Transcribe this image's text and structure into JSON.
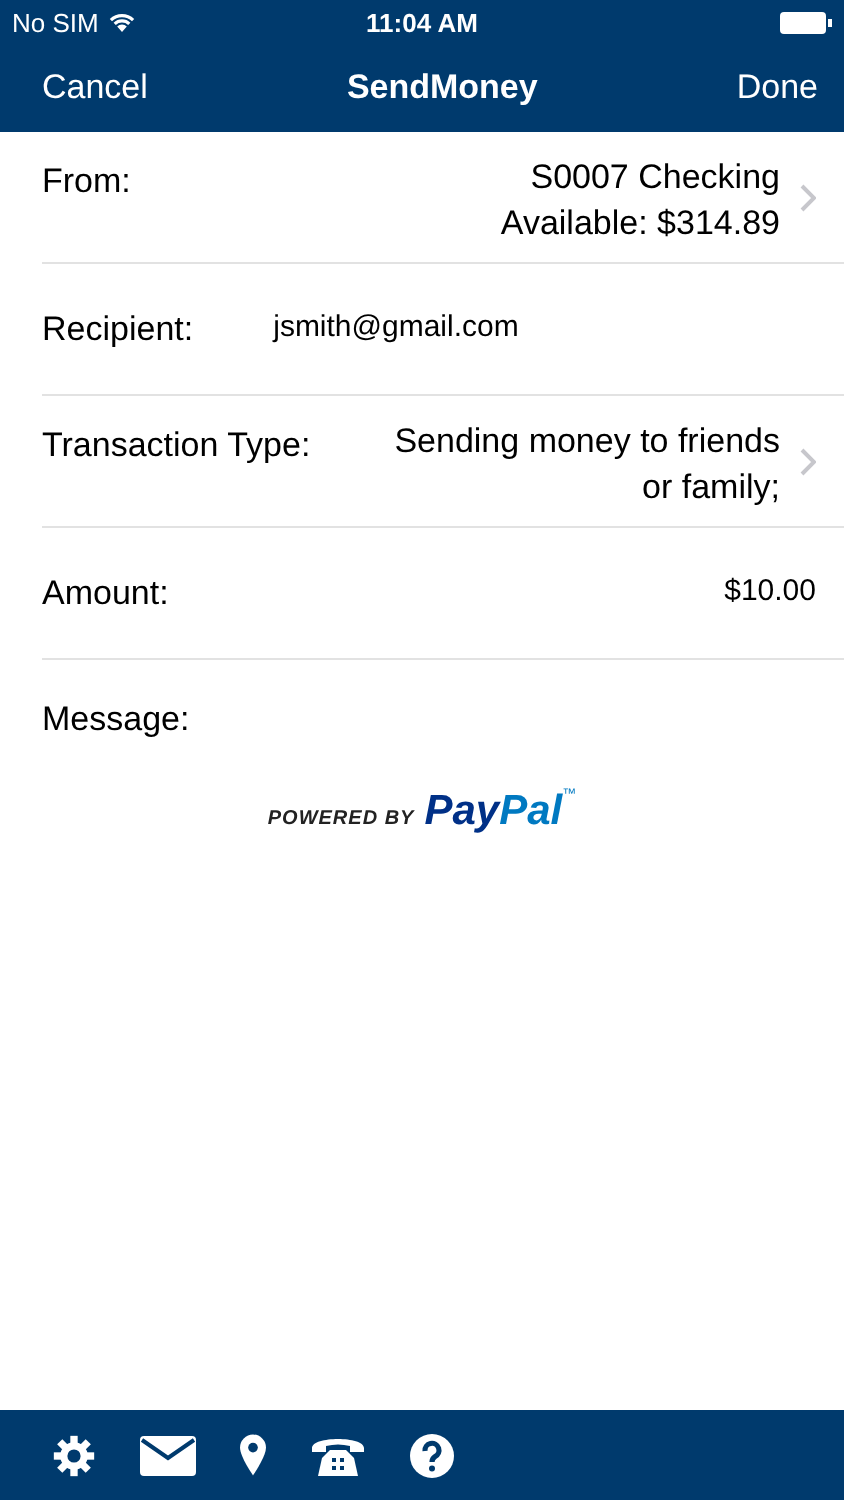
{
  "status_bar": {
    "carrier": "No SIM",
    "time": "11:04 AM"
  },
  "nav": {
    "left": "Cancel",
    "title": "SendMoney",
    "right": "Done"
  },
  "rows": [
    {
      "kind": "picker",
      "label": "From:",
      "value_lines": [
        "S0007 Checking",
        "Available: $314.89"
      ]
    },
    {
      "kind": "input",
      "label": "Recipient:",
      "value_lines": [
        "jsmith@gmail.com"
      ]
    },
    {
      "kind": "picker",
      "label": "Transaction Type:",
      "value_lines": [
        "Sending money to friends",
        "or family;"
      ]
    },
    {
      "kind": "amount",
      "label": "Amount:",
      "value_lines": [
        "$10.00"
      ]
    },
    {
      "kind": "input",
      "label": "Message:"
    }
  ],
  "powered_by": {
    "prefix": "POWERED BY",
    "brand_a": "Pay",
    "brand_b": "Pal",
    "tm": "™"
  },
  "tab_bar": [
    {
      "kind": "settings"
    },
    {
      "kind": "mail"
    },
    {
      "kind": "location"
    },
    {
      "kind": "phone"
    },
    {
      "kind": "help"
    }
  ]
}
